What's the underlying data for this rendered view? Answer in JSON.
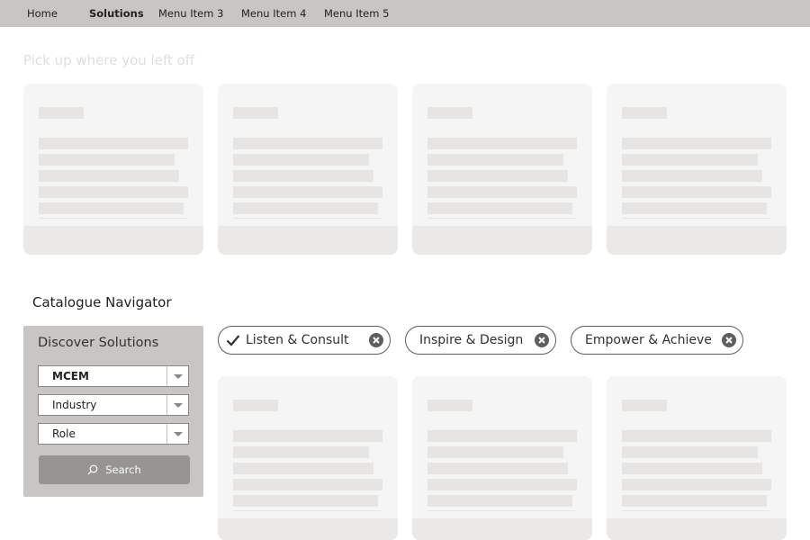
{
  "nav": {
    "items": [
      {
        "label": "Home",
        "active": false
      },
      {
        "label": "Solutions",
        "active": true
      },
      {
        "label": "Menu Item 3",
        "active": false
      },
      {
        "label": "Menu Item 4",
        "active": false
      },
      {
        "label": "Menu Item 5",
        "active": false
      }
    ]
  },
  "resume": {
    "title": "Pick up where you left off"
  },
  "catalogue": {
    "title": "Catalogue Navigator",
    "discover": {
      "title": "Discover Solutions",
      "selects": [
        {
          "value": "MCEM"
        },
        {
          "value": "Industry"
        },
        {
          "value": "Role"
        }
      ],
      "search_label": "Search"
    },
    "chips": [
      {
        "label": "Listen & Consult",
        "selected": true
      },
      {
        "label": "Inspire & Design",
        "selected": false
      },
      {
        "label": "Empower & Achieve",
        "selected": false
      }
    ]
  },
  "colors": {
    "nav_bg": "#c8c6c4",
    "card_bg": "#f5f5f5",
    "placeholder": "#e6e5e4",
    "button_bg": "#979593"
  }
}
